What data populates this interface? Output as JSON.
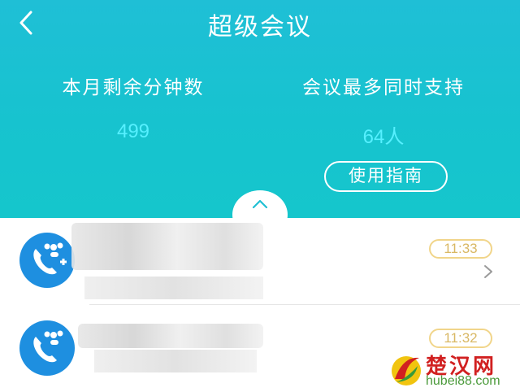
{
  "header": {
    "title": "超级会议",
    "back_icon": "chevron-left-icon"
  },
  "stats": {
    "minutes_label": "本月剩余分钟数",
    "minutes_value": "499",
    "capacity_label": "会议最多同时支持",
    "capacity_value": "64人",
    "accent_color": "#56f0ff"
  },
  "guide_button": {
    "label": "使用指南"
  },
  "collapse_icon": "chevron-up-icon",
  "meetings": [
    {
      "time": "11:33",
      "icon": "conference-call-icon"
    },
    {
      "time": "11:32",
      "icon": "conference-call-icon"
    }
  ],
  "watermark": {
    "text": "楚汉网",
    "sub": "hubei88.com"
  }
}
